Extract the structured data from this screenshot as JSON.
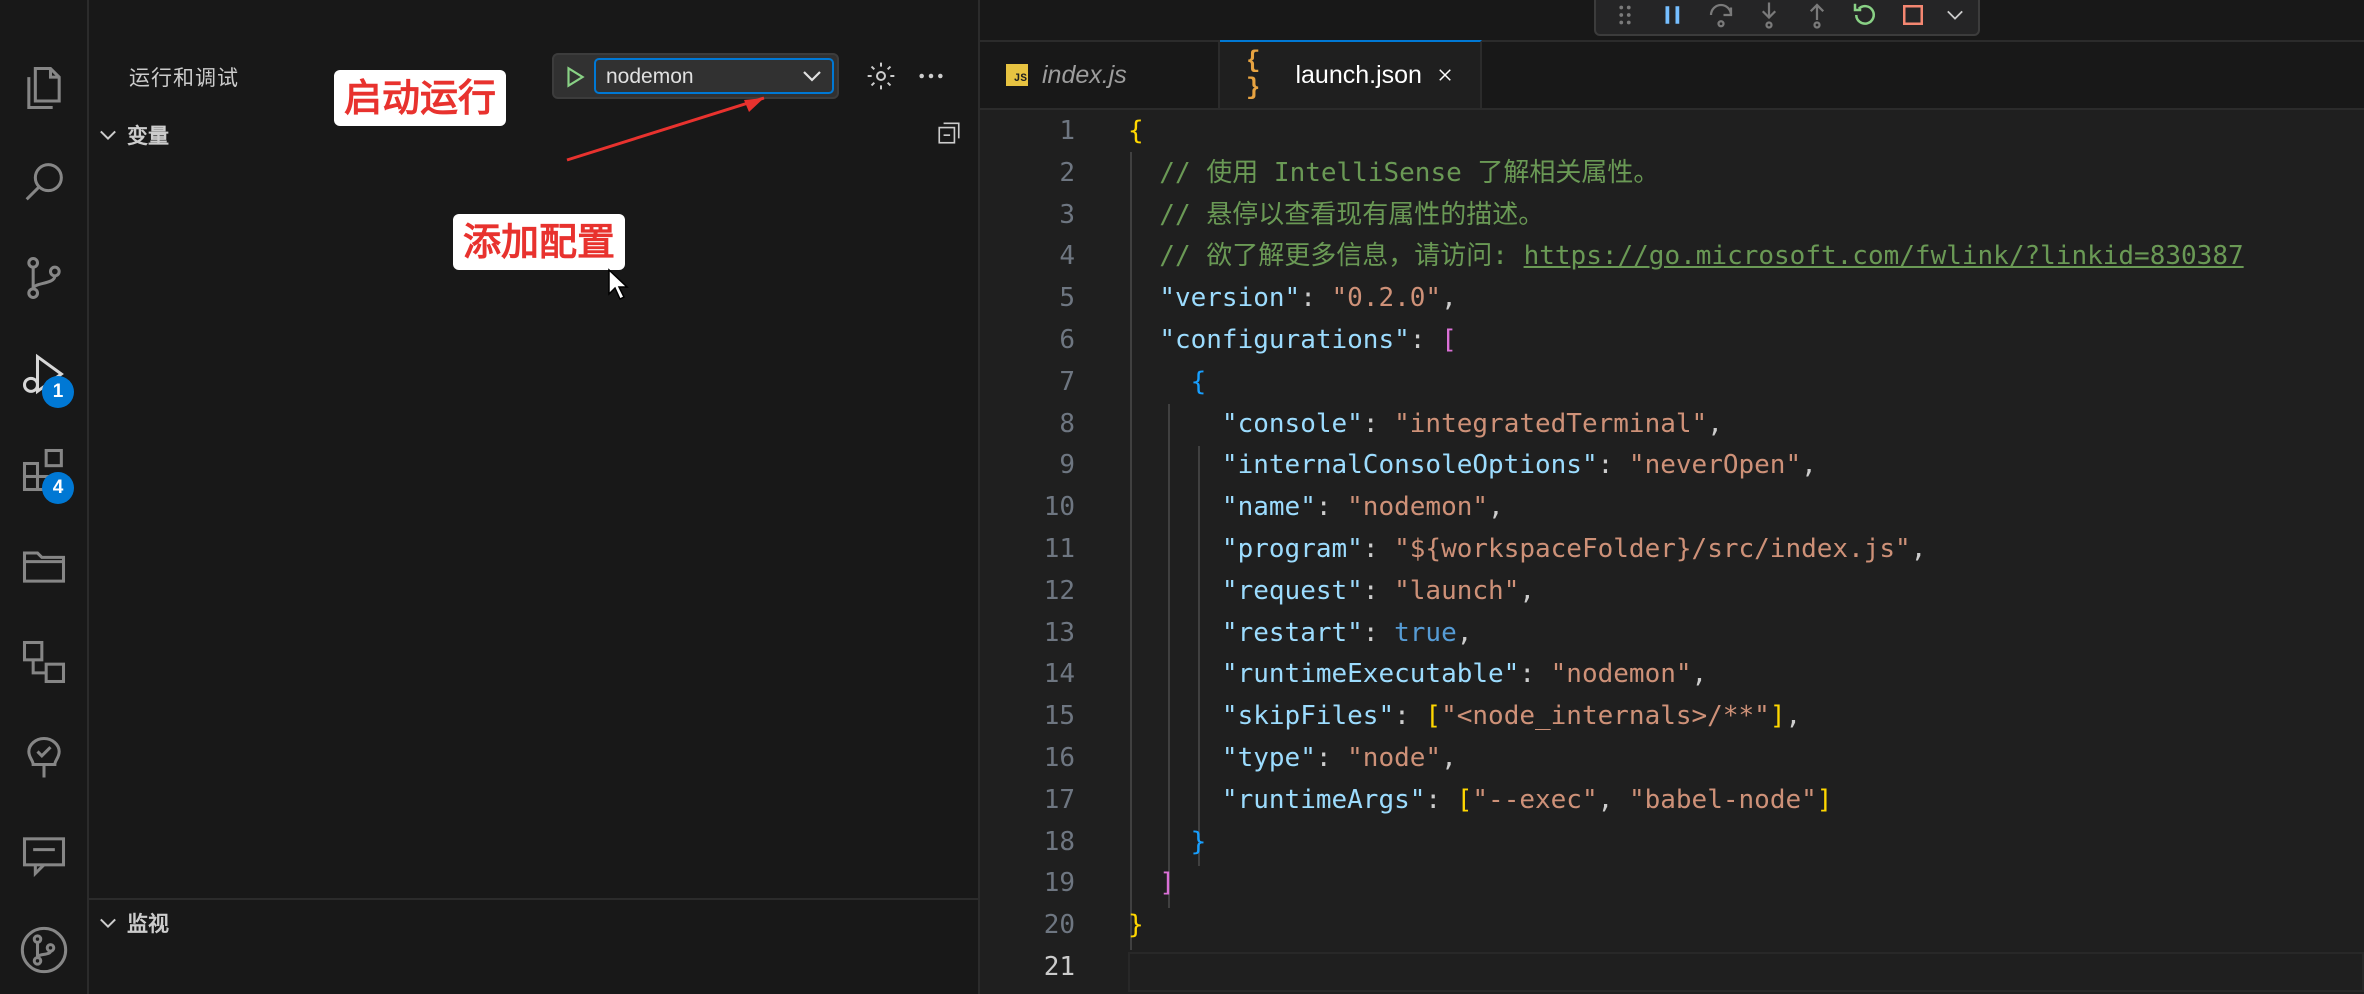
{
  "sidebar": {
    "title": "运行和调试",
    "run": {
      "selected_config": "nodemon"
    },
    "sections": {
      "variables": "变量",
      "watch": "监视"
    }
  },
  "activity_bar": {
    "items": [
      {
        "icon": "explorer-icon"
      },
      {
        "icon": "search-icon"
      },
      {
        "icon": "source-control-icon"
      },
      {
        "icon": "run-debug-icon",
        "badge": "1"
      },
      {
        "icon": "extensions-icon",
        "badge": "4"
      },
      {
        "icon": "folder-icon"
      },
      {
        "icon": "remote-explorer-icon"
      },
      {
        "icon": "testing-icon"
      },
      {
        "icon": "comments-icon"
      },
      {
        "icon": "git-graph-icon"
      }
    ]
  },
  "annotations": {
    "start_run": "启动运行",
    "add_config": "添加配置"
  },
  "tabs": [
    {
      "label": "index.js",
      "icon": "js-file-icon"
    },
    {
      "label": "launch.json",
      "icon": "json-file-icon",
      "active": true
    }
  ],
  "editor": {
    "current_line": 21,
    "lines": [
      [
        [
          "b1",
          "{"
        ]
      ],
      [
        [
          "com",
          "  // 使用 IntelliSense 了解相关属性。"
        ]
      ],
      [
        [
          "com",
          "  // 悬停以查看现有属性的描述。"
        ]
      ],
      [
        [
          "com",
          "  // 欲了解更多信息，请访问: "
        ],
        [
          "link",
          "https://go.microsoft.com/fwlink/?linkid=830387"
        ]
      ],
      [
        [
          "p",
          "  "
        ],
        [
          "key",
          "\"version\""
        ],
        [
          "p",
          ": "
        ],
        [
          "str",
          "\"0.2.0\""
        ],
        [
          "p",
          ","
        ]
      ],
      [
        [
          "p",
          "  "
        ],
        [
          "key",
          "\"configurations\""
        ],
        [
          "p",
          ": "
        ],
        [
          "b2",
          "["
        ]
      ],
      [
        [
          "p",
          "    "
        ],
        [
          "b3",
          "{"
        ]
      ],
      [
        [
          "p",
          "      "
        ],
        [
          "key",
          "\"console\""
        ],
        [
          "p",
          ": "
        ],
        [
          "str",
          "\"integratedTerminal\""
        ],
        [
          "p",
          ","
        ]
      ],
      [
        [
          "p",
          "      "
        ],
        [
          "key",
          "\"internalConsoleOptions\""
        ],
        [
          "p",
          ": "
        ],
        [
          "str",
          "\"neverOpen\""
        ],
        [
          "p",
          ","
        ]
      ],
      [
        [
          "p",
          "      "
        ],
        [
          "key",
          "\"name\""
        ],
        [
          "p",
          ": "
        ],
        [
          "str",
          "\"nodemon\""
        ],
        [
          "p",
          ","
        ]
      ],
      [
        [
          "p",
          "      "
        ],
        [
          "key",
          "\"program\""
        ],
        [
          "p",
          ": "
        ],
        [
          "str",
          "\"${workspaceFolder}/src/index.js\""
        ],
        [
          "p",
          ","
        ]
      ],
      [
        [
          "p",
          "      "
        ],
        [
          "key",
          "\"request\""
        ],
        [
          "p",
          ": "
        ],
        [
          "str",
          "\"launch\""
        ],
        [
          "p",
          ","
        ]
      ],
      [
        [
          "p",
          "      "
        ],
        [
          "key",
          "\"restart\""
        ],
        [
          "p",
          ": "
        ],
        [
          "bool",
          "true"
        ],
        [
          "p",
          ","
        ]
      ],
      [
        [
          "p",
          "      "
        ],
        [
          "key",
          "\"runtimeExecutable\""
        ],
        [
          "p",
          ": "
        ],
        [
          "str",
          "\"nodemon\""
        ],
        [
          "p",
          ","
        ]
      ],
      [
        [
          "p",
          "      "
        ],
        [
          "key",
          "\"skipFiles\""
        ],
        [
          "p",
          ": "
        ],
        [
          "b1",
          "["
        ],
        [
          "str",
          "\"<node_internals>/**\""
        ],
        [
          "b1",
          "]"
        ],
        [
          "p",
          ","
        ]
      ],
      [
        [
          "p",
          "      "
        ],
        [
          "key",
          "\"type\""
        ],
        [
          "p",
          ": "
        ],
        [
          "str",
          "\"node\""
        ],
        [
          "p",
          ","
        ]
      ],
      [
        [
          "p",
          "      "
        ],
        [
          "key",
          "\"runtimeArgs\""
        ],
        [
          "p",
          ": "
        ],
        [
          "b1",
          "["
        ],
        [
          "str",
          "\"--exec\""
        ],
        [
          "p",
          ", "
        ],
        [
          "str",
          "\"babel-node\""
        ],
        [
          "b1",
          "]"
        ]
      ],
      [
        [
          "p",
          "    "
        ],
        [
          "b3",
          "}"
        ]
      ],
      [
        [
          "p",
          "  "
        ],
        [
          "b2",
          "]"
        ]
      ],
      [
        [
          "b1",
          "}"
        ]
      ],
      [
        [
          "p",
          ""
        ]
      ]
    ]
  },
  "colors": {
    "accent": "#0078d4",
    "annotation_red": "#e8322e"
  }
}
